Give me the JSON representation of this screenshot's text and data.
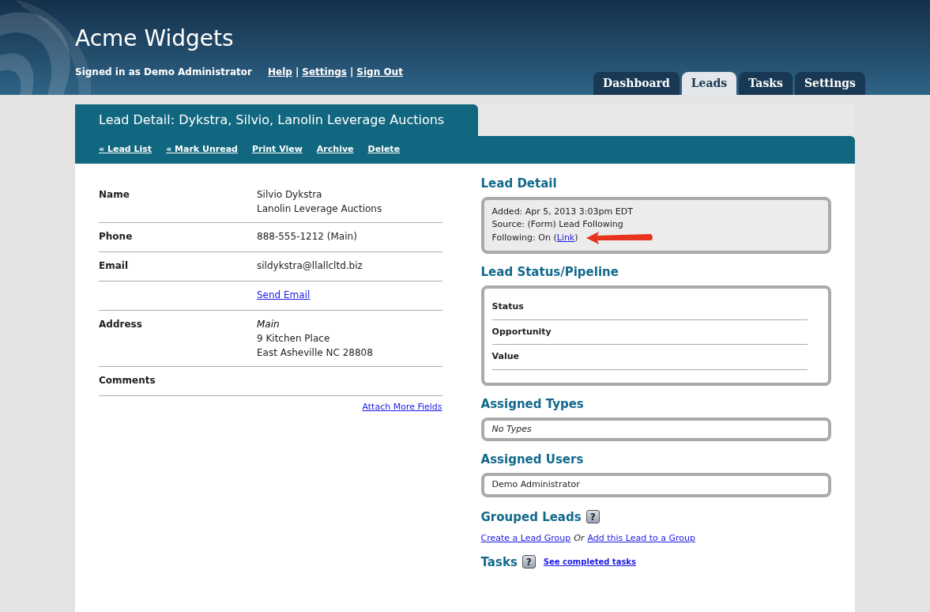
{
  "header": {
    "company": "Acme Widgets",
    "signed_in": "Signed in as Demo Administrator",
    "links": [
      "Help",
      "Settings",
      "Sign Out"
    ],
    "separator": "|"
  },
  "tabs": [
    {
      "label": "Dashboard",
      "selected": false
    },
    {
      "label": "Leads",
      "selected": true
    },
    {
      "label": "Tasks",
      "selected": false
    },
    {
      "label": "Settings",
      "selected": false
    }
  ],
  "panel": {
    "title": "Lead Detail: Dykstra, Silvio, Lanolin Leverage Auctions",
    "actions": [
      "« Lead List",
      "« Mark Unread",
      "Print View",
      "Archive",
      "Delete"
    ]
  },
  "fields": [
    {
      "label": "Name",
      "lines": [
        {
          "kind": "text",
          "text": "Silvio Dykstra"
        },
        {
          "kind": "text",
          "text": "Lanolin Leverage Auctions"
        }
      ]
    },
    {
      "label": "Phone",
      "lines": [
        {
          "kind": "text",
          "text": "888-555-1212 (Main)"
        }
      ]
    },
    {
      "label": "Email",
      "lines": [
        {
          "kind": "text",
          "text": "sildykstra@llallcltd.biz"
        }
      ]
    },
    {
      "lines": [
        {
          "kind": "link",
          "text": "Send Email"
        }
      ]
    },
    {
      "label": "Address",
      "lines": [
        {
          "kind": "italic",
          "text": "Main"
        },
        {
          "kind": "text",
          "text": "9 Kitchen Place"
        },
        {
          "kind": "text",
          "text": "East Asheville NC 28808"
        }
      ]
    },
    {
      "label": "Comments"
    }
  ],
  "attach_link": "Attach More Fields",
  "lead_detail": {
    "heading": "Lead Detail",
    "lines": [
      "Added: Apr 5, 2013 3:03pm EDT",
      "Source: (Form) Lead Following"
    ],
    "following": {
      "prefix": "Following: On (",
      "link": "Link",
      "suffix": ")"
    }
  },
  "pipeline": {
    "heading": "Lead Status/Pipeline",
    "rows": [
      "Status",
      "Opportunity",
      "Value"
    ]
  },
  "assigned_types": {
    "heading": "Assigned Types",
    "value": "No Types"
  },
  "assigned_users": {
    "heading": "Assigned Users",
    "value": "Demo Administrator"
  },
  "grouped_leads": {
    "heading": "Grouped Leads",
    "help": "?",
    "link1": "Create a Lead Group",
    "or": "Or",
    "link2": "Add this Lead to a Group"
  },
  "tasks": {
    "heading": "Tasks",
    "help": "?",
    "link": "See completed tasks"
  }
}
